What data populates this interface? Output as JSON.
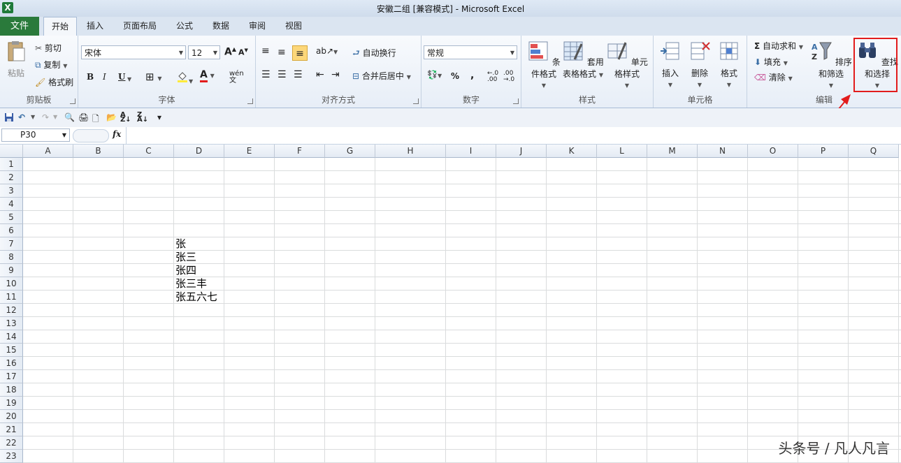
{
  "window": {
    "title": "安徽二组 [兼容模式] - Microsoft Excel",
    "app_icon": "X"
  },
  "tabs": {
    "file": "文件",
    "items": [
      "开始",
      "插入",
      "页面布局",
      "公式",
      "数据",
      "审阅",
      "视图"
    ],
    "active": "开始"
  },
  "ribbon": {
    "clipboard": {
      "label": "剪贴板",
      "paste": "粘贴",
      "cut": "剪切",
      "copy": "复制",
      "format_painter": "格式刷"
    },
    "font": {
      "label": "字体",
      "name": "宋体",
      "size": "12",
      "bold": "B",
      "italic": "I",
      "underline": "U"
    },
    "alignment": {
      "label": "对齐方式",
      "wrap": "自动换行",
      "merge": "合并后居中"
    },
    "number": {
      "label": "数字",
      "format": "常规",
      "percent": "%",
      "comma": ","
    },
    "styles": {
      "label": "样式",
      "conditional": "条件格式",
      "table_format_1": "套用",
      "table_format_2": "表格格式",
      "cell_style": "单元格样式"
    },
    "cells": {
      "label": "单元格",
      "insert": "插入",
      "delete": "删除",
      "format": "格式"
    },
    "editing": {
      "label": "编辑",
      "autosum": "自动求和",
      "fill": "填充",
      "clear": "清除",
      "sort_filter": "排序和筛选",
      "find_select": "查找和选择"
    }
  },
  "formula_bar": {
    "name_box": "P30",
    "fx": "fx",
    "value": ""
  },
  "columns": [
    "A",
    "B",
    "C",
    "D",
    "E",
    "F",
    "G",
    "H",
    "I",
    "J",
    "K",
    "L",
    "M",
    "N",
    "O",
    "P",
    "Q"
  ],
  "rows": [
    "1",
    "2",
    "3",
    "4",
    "5",
    "6",
    "7",
    "8",
    "9",
    "10",
    "11",
    "12",
    "13",
    "14",
    "15",
    "16",
    "17",
    "18",
    "19",
    "20",
    "21",
    "22",
    "23"
  ],
  "cells": {
    "D7": "张",
    "D8": "张三",
    "D9": "张四",
    "D10": "张三丰",
    "D11": "张五六七"
  },
  "watermark": "头条号 / 凡人凡言",
  "colors": {
    "file_tab": "#2a7a3b",
    "highlight": "#e21c1c",
    "arrow": "#e21c1c"
  }
}
